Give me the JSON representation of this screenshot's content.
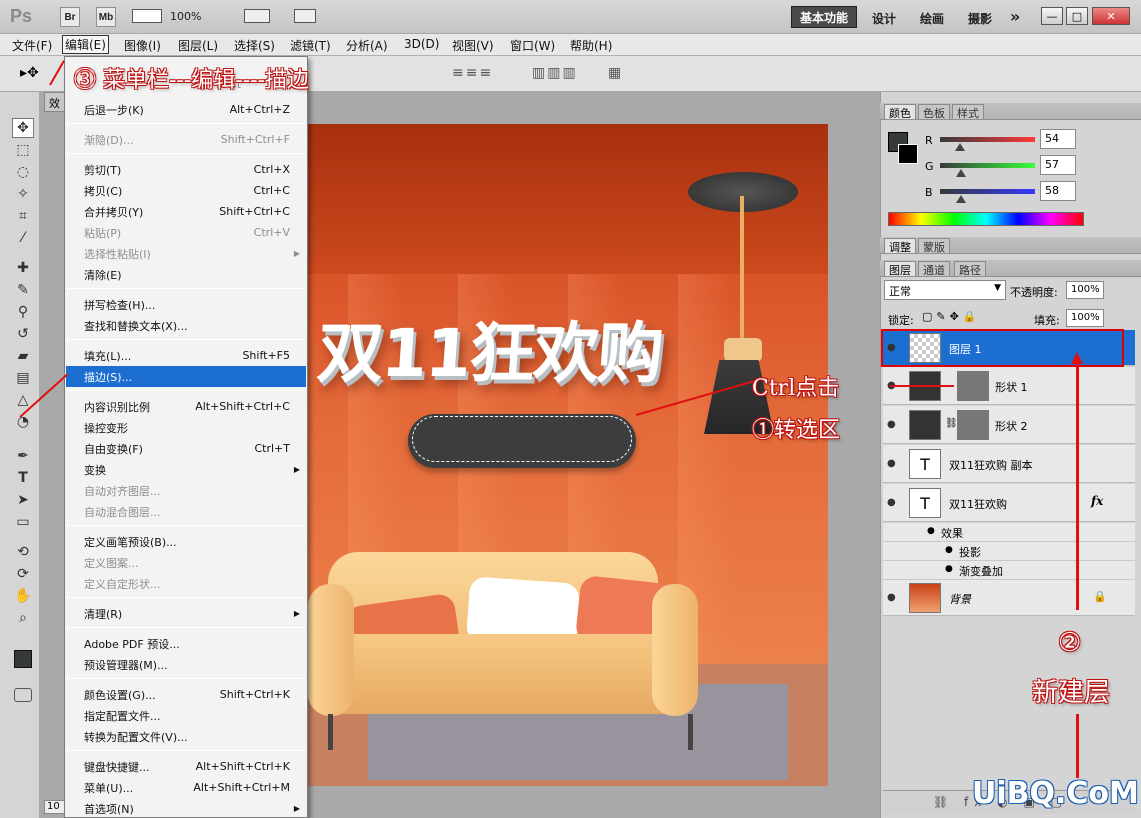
{
  "appbar": {
    "logo": "Ps",
    "btn_br": "Br",
    "btn_mb": "Mb",
    "zoom": "100%",
    "workspace_active": "基本功能",
    "workspaces": [
      "设计",
      "绘画",
      "摄影"
    ],
    "more": "»",
    "win_min": "—",
    "win_max": "□",
    "win_close": "✕"
  },
  "menubar": [
    {
      "label": "文件(F)"
    },
    {
      "label": "编辑(E)"
    },
    {
      "label": "图像(I)"
    },
    {
      "label": "图层(L)"
    },
    {
      "label": "选择(S)"
    },
    {
      "label": "滤镜(T)"
    },
    {
      "label": "分析(A)"
    },
    {
      "label": "3D(D)"
    },
    {
      "label": "视图(V)"
    },
    {
      "label": "窗口(W)"
    },
    {
      "label": "帮助(H)"
    }
  ],
  "doc_tab": "效",
  "doc_zoom": "10",
  "edit_menu": {
    "top_partial": "Shift",
    "items": [
      {
        "label": "后退一步(K)",
        "shortcut": "Alt+Ctrl+Z"
      },
      {
        "label": "渐隐(D)...",
        "shortcut": "Shift+Ctrl+F"
      },
      {
        "label": "剪切(T)",
        "shortcut": "Ctrl+X"
      },
      {
        "label": "拷贝(C)",
        "shortcut": "Ctrl+C"
      },
      {
        "label": "合并拷贝(Y)",
        "shortcut": "Shift+Ctrl+C"
      },
      {
        "label": "粘贴(P)",
        "shortcut": "Ctrl+V"
      },
      {
        "label": "选择性粘贴(I)",
        "shortcut": ""
      },
      {
        "label": "清除(E)",
        "shortcut": ""
      },
      {
        "label": "拼写检查(H)...",
        "shortcut": ""
      },
      {
        "label": "查找和替换文本(X)...",
        "shortcut": ""
      },
      {
        "label": "填充(L)...",
        "shortcut": "Shift+F5"
      },
      {
        "label": "描边(S)...",
        "shortcut": ""
      },
      {
        "label": "内容识别比例",
        "shortcut": "Alt+Shift+Ctrl+C"
      },
      {
        "label": "操控变形",
        "shortcut": ""
      },
      {
        "label": "自由变换(F)",
        "shortcut": "Ctrl+T"
      },
      {
        "label": "变换",
        "shortcut": ""
      },
      {
        "label": "自动对齐图层...",
        "shortcut": ""
      },
      {
        "label": "自动混合图层...",
        "shortcut": ""
      },
      {
        "label": "定义画笔预设(B)...",
        "shortcut": ""
      },
      {
        "label": "定义图案...",
        "shortcut": ""
      },
      {
        "label": "定义自定形状...",
        "shortcut": ""
      },
      {
        "label": "清理(R)",
        "shortcut": ""
      },
      {
        "label": "Adobe PDF 预设...",
        "shortcut": ""
      },
      {
        "label": "预设管理器(M)...",
        "shortcut": ""
      },
      {
        "label": "颜色设置(G)...",
        "shortcut": "Shift+Ctrl+K"
      },
      {
        "label": "指定配置文件...",
        "shortcut": ""
      },
      {
        "label": "转换为配置文件(V)...",
        "shortcut": ""
      },
      {
        "label": "键盘快捷键...",
        "shortcut": "Alt+Shift+Ctrl+K"
      },
      {
        "label": "菜单(U)...",
        "shortcut": "Alt+Shift+Ctrl+M"
      },
      {
        "label": "首选项(N)",
        "shortcut": ""
      }
    ]
  },
  "canvas": {
    "headline": "双11狂欢购"
  },
  "color_panel": {
    "tabs": [
      "颜色",
      "色板",
      "样式"
    ],
    "channels": [
      {
        "name": "R",
        "value": "54"
      },
      {
        "name": "G",
        "value": "57"
      },
      {
        "name": "B",
        "value": "58"
      }
    ],
    "fg_color": "#36393a"
  },
  "adjust_panel": {
    "tabs": [
      "调整",
      "蒙版"
    ]
  },
  "layers_panel": {
    "tabs": [
      "图层",
      "通道",
      "路径"
    ],
    "blend_mode": "正常",
    "opacity_label": "不透明度:",
    "opacity": "100%",
    "lock_label": "锁定:",
    "fill_label": "填充:",
    "fill": "100%",
    "layers": [
      {
        "name": "图层 1",
        "selected": true
      },
      {
        "name": "形状 1"
      },
      {
        "name": "形状 2"
      },
      {
        "name": "双11狂欢购 副本",
        "thumb": "T"
      },
      {
        "name": "双11狂欢购",
        "thumb": "T",
        "fx": "fx"
      },
      {
        "name": "背景"
      }
    ],
    "effects_label": "效果",
    "effects": [
      "投影",
      "渐变叠加"
    ]
  },
  "annotations": {
    "step3": "③ 菜单栏---编辑----描边",
    "step1_line1": "Ctrl点击",
    "step1_line2": "①转选区",
    "step2_num": "②",
    "step2_text": "新建层"
  },
  "watermark": "UiBQ.CoM",
  "accent_color": "#1c6fd1",
  "annotation_color": "#e01010"
}
